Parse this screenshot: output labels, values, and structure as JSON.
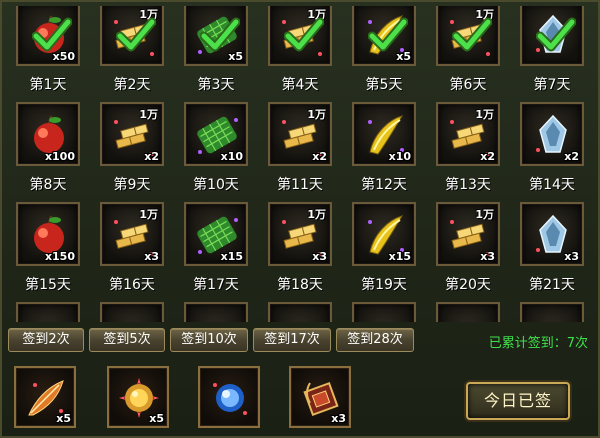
{
  "colors": {
    "accent_green": "#3fe04a",
    "slot_border": "#6b5a3a",
    "gold": "#c9a955"
  },
  "days": [
    {
      "label": "第1天",
      "icon": "apple-icon",
      "count": "x50",
      "wan": "",
      "claimed": true
    },
    {
      "label": "第2天",
      "icon": "gold-bars-icon",
      "count": "",
      "wan": "1万",
      "claimed": true
    },
    {
      "label": "第3天",
      "icon": "green-scale-icon",
      "count": "x5",
      "wan": "",
      "claimed": true
    },
    {
      "label": "第4天",
      "icon": "gold-bars-icon",
      "count": "",
      "wan": "1万",
      "claimed": true
    },
    {
      "label": "第5天",
      "icon": "horn-icon",
      "count": "x5",
      "wan": "",
      "claimed": true
    },
    {
      "label": "第6天",
      "icon": "gold-bars-icon",
      "count": "",
      "wan": "1万",
      "claimed": true
    },
    {
      "label": "第7天",
      "icon": "crystal-icon",
      "count": "",
      "wan": "",
      "claimed": true
    },
    {
      "label": "第8天",
      "icon": "apple-icon",
      "count": "x100",
      "wan": "",
      "claimed": false
    },
    {
      "label": "第9天",
      "icon": "gold-bars-icon",
      "count": "x2",
      "wan": "1万",
      "claimed": false
    },
    {
      "label": "第10天",
      "icon": "green-scale-icon",
      "count": "x10",
      "wan": "",
      "claimed": false
    },
    {
      "label": "第11天",
      "icon": "gold-bars-icon",
      "count": "x2",
      "wan": "1万",
      "claimed": false
    },
    {
      "label": "第12天",
      "icon": "horn-icon",
      "count": "x10",
      "wan": "",
      "claimed": false
    },
    {
      "label": "第13天",
      "icon": "gold-bars-icon",
      "count": "x2",
      "wan": "1万",
      "claimed": false
    },
    {
      "label": "第14天",
      "icon": "crystal-icon",
      "count": "x2",
      "wan": "",
      "claimed": false
    },
    {
      "label": "第15天",
      "icon": "apple-icon",
      "count": "x150",
      "wan": "",
      "claimed": false
    },
    {
      "label": "第16天",
      "icon": "gold-bars-icon",
      "count": "x3",
      "wan": "1万",
      "claimed": false
    },
    {
      "label": "第17天",
      "icon": "green-scale-icon",
      "count": "x15",
      "wan": "",
      "claimed": false
    },
    {
      "label": "第18天",
      "icon": "gold-bars-icon",
      "count": "x3",
      "wan": "1万",
      "claimed": false
    },
    {
      "label": "第19天",
      "icon": "horn-icon",
      "count": "x15",
      "wan": "",
      "claimed": false
    },
    {
      "label": "第20天",
      "icon": "gold-bars-icon",
      "count": "x3",
      "wan": "1万",
      "claimed": false
    },
    {
      "label": "第21天",
      "icon": "crystal-icon",
      "count": "x3",
      "wan": "",
      "claimed": false
    }
  ],
  "milestones": [
    {
      "label": "签到2次"
    },
    {
      "label": "签到5次"
    },
    {
      "label": "签到10次"
    },
    {
      "label": "签到17次"
    },
    {
      "label": "签到28次"
    }
  ],
  "total": {
    "label": "已累计签到：",
    "value": "7次"
  },
  "rewards": [
    {
      "icon": "feather-icon",
      "count": "x5"
    },
    {
      "icon": "gold-orb-icon",
      "count": "x5"
    },
    {
      "icon": "blue-orb-icon",
      "count": ""
    },
    {
      "icon": "box-icon",
      "count": "x3"
    }
  ],
  "signed_button": "今日已签"
}
